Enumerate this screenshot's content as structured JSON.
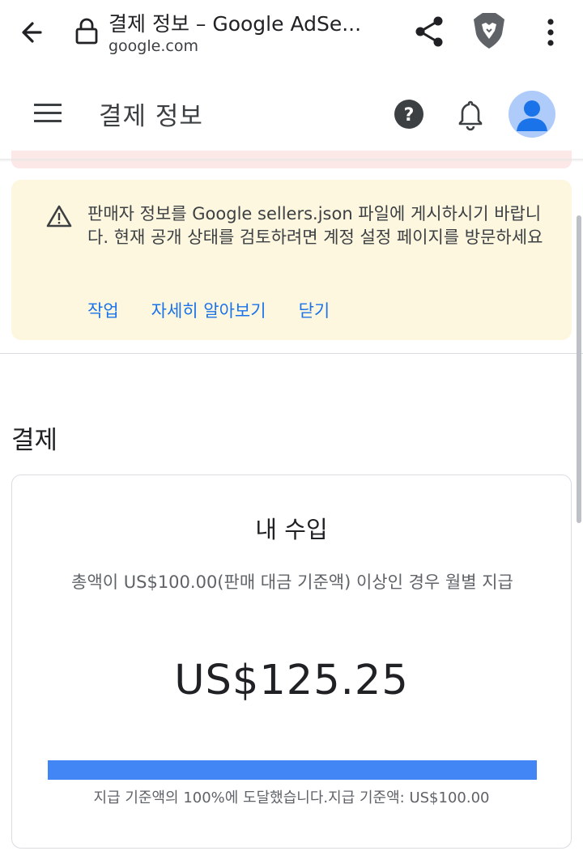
{
  "browser": {
    "page_title": "결제 정보 – Google AdSe...",
    "domain": "google.com"
  },
  "app_bar": {
    "title": "결제 정보"
  },
  "banner": {
    "message": "판매자 정보를 Google sellers.json 파일에 게시하시기 바랍니다. 현재 공개 상태를 검토하려면 계정 설정 페이지를 방문하세요",
    "actions": [
      "작업",
      "자세히 알아보기",
      "닫기"
    ]
  },
  "section": {
    "title": "결제"
  },
  "earnings_card": {
    "title": "내 수입",
    "description": "총액이 US$100.00(판매 대금 기준액) 이상인 경우 월별 지급",
    "amount": "US$125.25",
    "progress_percent": 100,
    "progress_caption": "지급 기준액의 100%에 도달했습니다.지급 기준액: US$100.00"
  },
  "colors": {
    "accent": "#1a73e8",
    "progress": "#4285f4",
    "banner_bg": "#fef7e0",
    "avatar_bg": "#aecbfa"
  },
  "icons": [
    "back-arrow-icon",
    "lock-icon",
    "share-icon",
    "brave-lion-icon",
    "more-vert-icon",
    "menu-icon",
    "help-icon",
    "bell-icon",
    "avatar-icon",
    "warning-icon"
  ]
}
